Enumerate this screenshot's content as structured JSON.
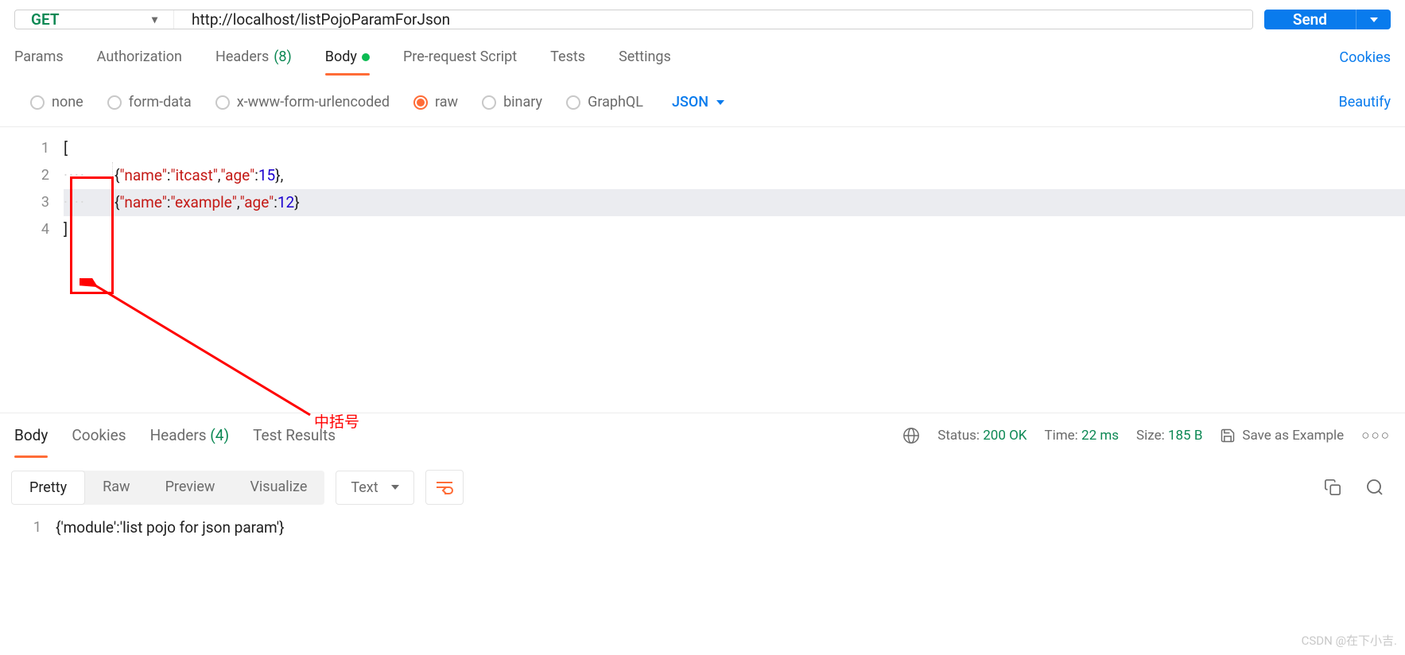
{
  "request": {
    "method": "GET",
    "url": "http://localhost/listPojoParamForJson",
    "send": "Send"
  },
  "tabs": {
    "params": "Params",
    "auth": "Authorization",
    "headers": "Headers",
    "headers_count": "(8)",
    "body": "Body",
    "prereq": "Pre-request Script",
    "tests": "Tests",
    "settings": "Settings",
    "cookies": "Cookies"
  },
  "body_types": {
    "none": "none",
    "form": "form-data",
    "url": "x-www-form-urlencoded",
    "raw": "raw",
    "binary": "binary",
    "graphql": "GraphQL",
    "format": "JSON",
    "beautify": "Beautify"
  },
  "editor": {
    "line1_no": "1",
    "line2_no": "2",
    "line3_no": "3",
    "line4_no": "4",
    "open": "[",
    "close": "]",
    "l2_o": "{",
    "l2_k1": "\"name\"",
    "l2_c1": ":",
    "l2_v1": "\"itcast\"",
    "l2_cm": ",",
    "l2_k2": "\"age\"",
    "l2_c2": ":",
    "l2_v2": "15",
    "l2_e": "},",
    "l3_o": "{",
    "l3_k1": "\"name\"",
    "l3_c1": ":",
    "l3_v1": "\"example\"",
    "l3_cm": ",",
    "l3_k2": "\"age\"",
    "l3_c2": ":",
    "l3_v2": "12",
    "l3_e": "}"
  },
  "annotation": "中括号",
  "response": {
    "tabs": {
      "body": "Body",
      "cookies": "Cookies",
      "headers": "Headers",
      "headers_count": "(4)",
      "tests": "Test Results"
    },
    "status_lbl": "Status:",
    "status_val": "200 OK",
    "time_lbl": "Time:",
    "time_val": "22 ms",
    "size_lbl": "Size:",
    "size_val": "185 B",
    "save": "Save as Example",
    "views": {
      "pretty": "Pretty",
      "raw": "Raw",
      "preview": "Preview",
      "visualize": "Visualize",
      "format": "Text"
    },
    "body_line_no": "1",
    "body_o": "{",
    "body_k": "'module'",
    "body_c": ":",
    "body_v": "'list pojo for json param'",
    "body_e": "}"
  },
  "watermark": "CSDN @在下小吉."
}
